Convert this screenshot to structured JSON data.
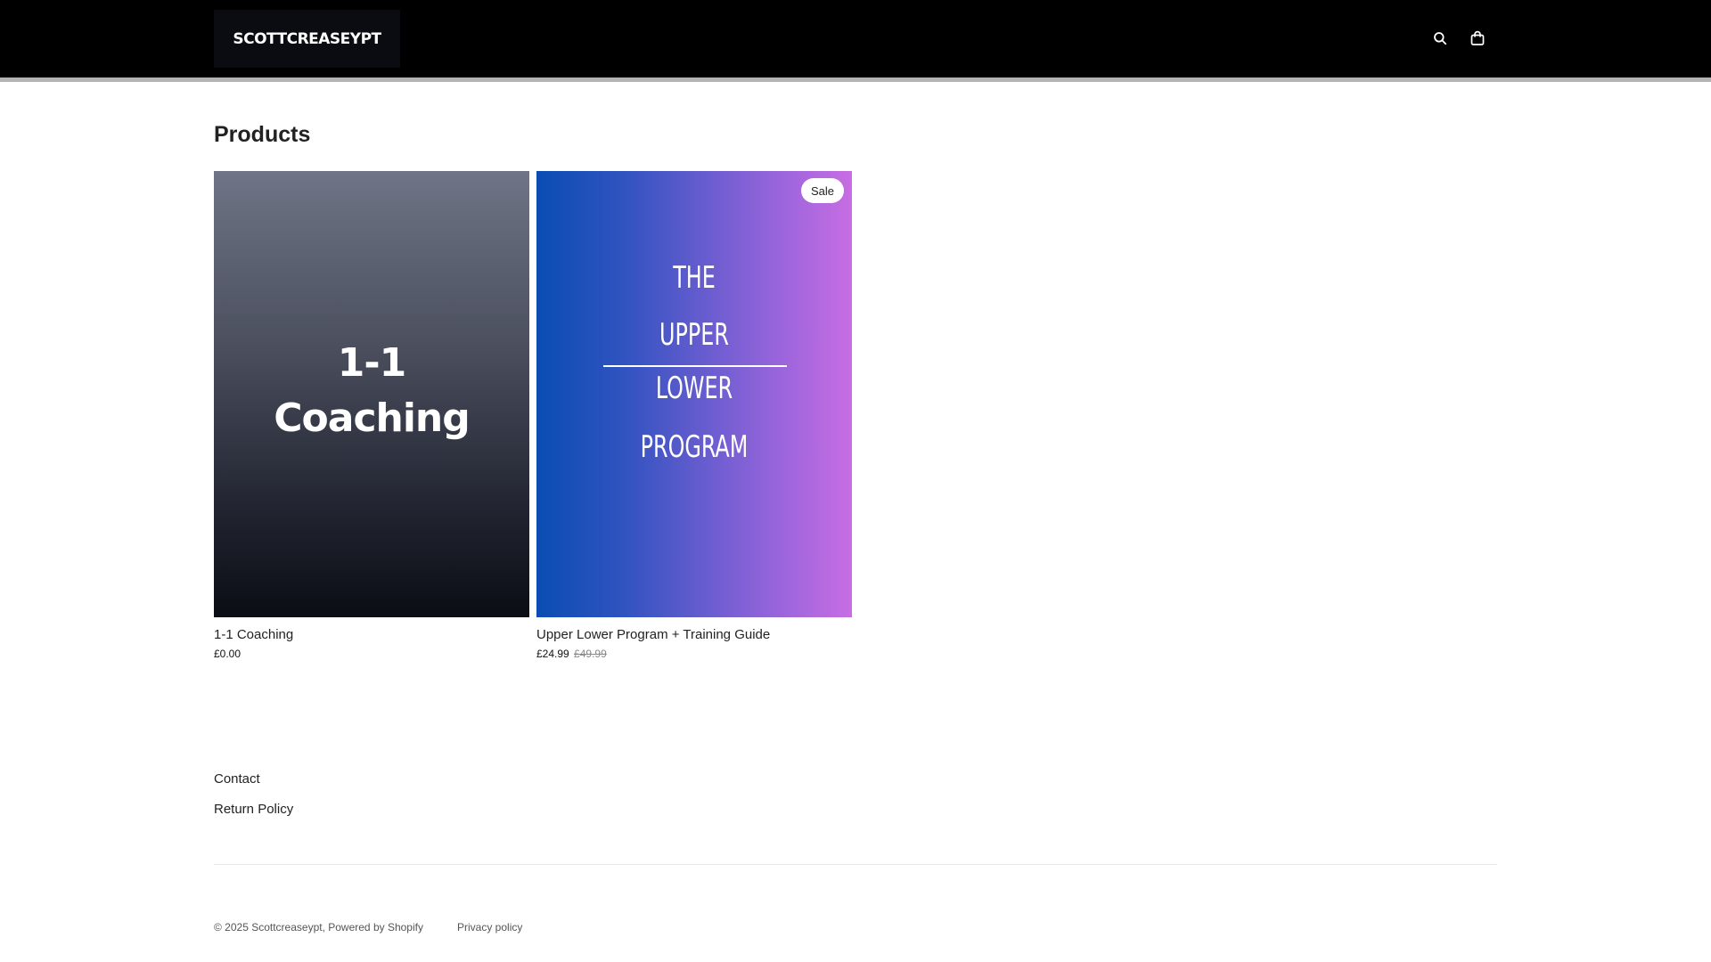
{
  "header": {
    "logo_text": "SCOTTCREASEYPT",
    "search_icon": "search-icon",
    "cart_icon": "bag-icon"
  },
  "main": {
    "title": "Products",
    "products": [
      {
        "image_text": [
          "1-1",
          "Coaching"
        ],
        "title": "1-1 Coaching",
        "price": "£0.00"
      },
      {
        "image_text": [
          "THE",
          "UPPER",
          "LOWER",
          "PROGRAM"
        ],
        "badge": "Sale",
        "title": "Upper Lower Program + Training Guide",
        "price": "£24.99",
        "compare_price": "£49.99"
      }
    ]
  },
  "footer": {
    "links": [
      "Contact",
      "Return Policy"
    ],
    "copyright": "© 2025 Scottcreaseypt, Powered by Shopify",
    "privacy": "Privacy policy"
  },
  "colors": {
    "header_bg": "#000000",
    "badge_bg": "#ffffff",
    "program_gradient_start": "#0a4db2",
    "program_gradient_end": "#c86de3"
  }
}
